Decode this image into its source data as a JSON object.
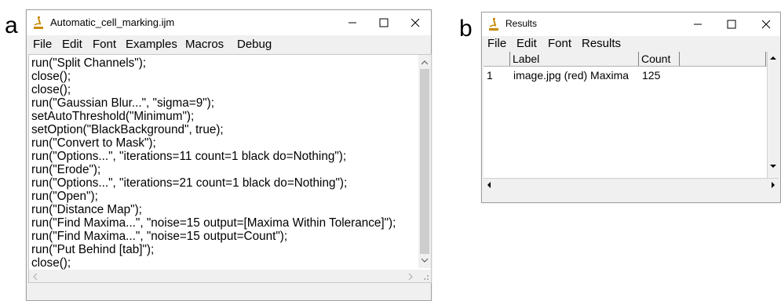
{
  "panels": {
    "a": "a",
    "b": "b"
  },
  "editor": {
    "title": "Automatic_cell_marking.ijm",
    "menu": [
      "File",
      "Edit",
      "Font",
      "Examples",
      "Macros",
      "Debug"
    ],
    "code_lines": [
      "run(\"Split Channels\");",
      "close();",
      "close();",
      "run(\"Gaussian Blur...\", \"sigma=9\");",
      "setAutoThreshold(\"Minimum\");",
      "setOption(\"BlackBackground\", true);",
      "run(\"Convert to Mask\");",
      "run(\"Options...\", \"iterations=11 count=1 black do=Nothing\");",
      "run(\"Erode\");",
      "run(\"Options...\", \"iterations=21 count=1 black do=Nothing\");",
      "run(\"Open\");",
      "run(\"Distance Map\");",
      "run(\"Find Maxima...\", \"noise=15 output=[Maxima Within Tolerance]\");",
      "run(\"Find Maxima...\", \"noise=15 output=Count\");",
      "run(\"Put Behind [tab]\");",
      "close();"
    ]
  },
  "results": {
    "title": "Results",
    "menu": [
      "File",
      "Edit",
      "Font",
      "Results"
    ],
    "columns": [
      "",
      "Label",
      "Count"
    ],
    "rows": [
      {
        "index": "1",
        "label": "image.jpg (red) Maxima",
        "count": "125"
      }
    ]
  },
  "icons": {
    "app": "imagej-microscope-icon",
    "minimize": "minimize-icon",
    "maximize": "maximize-icon",
    "close": "close-icon"
  }
}
